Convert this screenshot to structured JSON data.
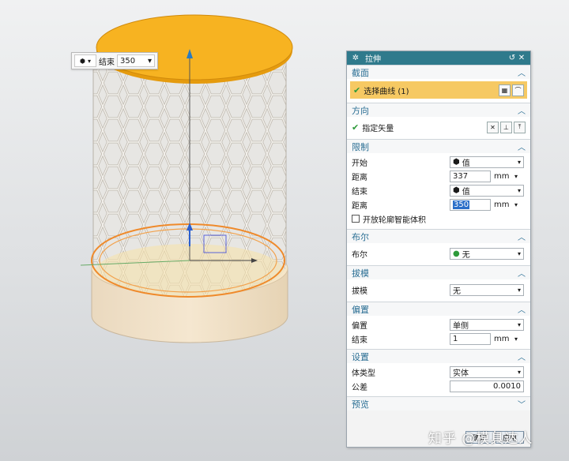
{
  "floater": {
    "label": "结束",
    "value": "350"
  },
  "dialog": {
    "title": "拉伸",
    "sections": {
      "section": {
        "title": "截面",
        "select_curve": "选择曲线 (1)"
      },
      "direction": {
        "title": "方向",
        "specify_vector": "指定矢量"
      },
      "limits": {
        "title": "限制",
        "start_label": "开始",
        "start_value": "值",
        "dist1_label": "距离",
        "dist1_value": "337",
        "dist1_unit": "mm",
        "end_label": "结束",
        "end_value": "值",
        "dist2_label": "距离",
        "dist2_value": "350",
        "dist2_unit": "mm",
        "open_profile": "开放轮廓智能体积"
      },
      "boolean": {
        "title": "布尔",
        "label": "布尔",
        "value": "无"
      },
      "draft": {
        "title": "拔模",
        "label": "拔模",
        "value": "无"
      },
      "offset": {
        "title": "偏置",
        "label": "偏置",
        "value": "单侧",
        "end_label": "结束",
        "end_value": "1",
        "end_unit": "mm"
      },
      "settings": {
        "title": "设置",
        "body_type_label": "体类型",
        "body_type_value": "实体",
        "tolerance_label": "公差",
        "tolerance_value": "0.0010"
      },
      "preview": {
        "title": "预览"
      }
    },
    "buttons": {
      "ok": "确定",
      "apply": "应用"
    }
  },
  "watermark": "知乎 @模具达人",
  "colors": {
    "titlebar": "#2f7a8c",
    "highlight": "#f6c963",
    "lid": "#f5b21c",
    "base": "#e9d7bb"
  }
}
